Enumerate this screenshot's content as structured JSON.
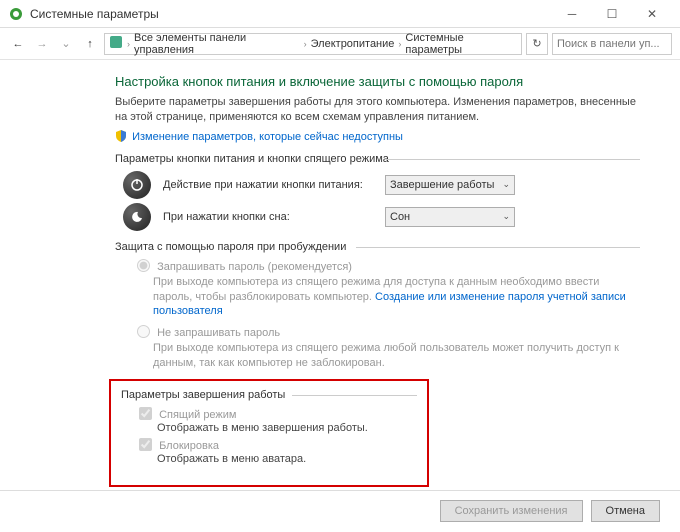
{
  "window": {
    "title": "Системные параметры"
  },
  "nav": {
    "crumb1": "Все элементы панели управления",
    "crumb2": "Электропитание",
    "crumb3": "Системные параметры",
    "search_placeholder": "Поиск в панели уп..."
  },
  "page": {
    "heading": "Настройка кнопок питания и включение защиты с помощью пароля",
    "intro": "Выберите параметры завершения работы для этого компьютера. Изменения параметров, внесенные на этой странице, применяются ко всем схемам управления питанием.",
    "admin_link": "Изменение параметров, которые сейчас недоступны"
  },
  "buttons_section": {
    "title": "Параметры кнопки питания и кнопки спящего режима",
    "power_label": "Действие при нажатии кнопки питания:",
    "power_value": "Завершение работы",
    "sleep_label": "При нажатии кнопки сна:",
    "sleep_value": "Сон"
  },
  "password_section": {
    "title": "Защита с помощью пароля при пробуждении",
    "opt1_label": "Запрашивать пароль (рекомендуется)",
    "opt1_desc_a": "При выходе компьютера из спящего режима для доступа к данным необходимо ввести пароль, чтобы разблокировать компьютер. ",
    "opt1_link": "Создание или изменение пароля учетной записи пользователя",
    "opt2_label": "Не запрашивать пароль",
    "opt2_desc": "При выходе компьютера из спящего режима любой пользователь может получить доступ к данным, так как компьютер не заблокирован."
  },
  "shutdown_section": {
    "title": "Параметры завершения работы",
    "chk1_label": "Спящий режим",
    "chk1_desc": "Отображать в меню завершения работы.",
    "chk2_label": "Блокировка",
    "chk2_desc": "Отображать в меню аватара."
  },
  "footer": {
    "save": "Сохранить изменения",
    "cancel": "Отмена"
  }
}
